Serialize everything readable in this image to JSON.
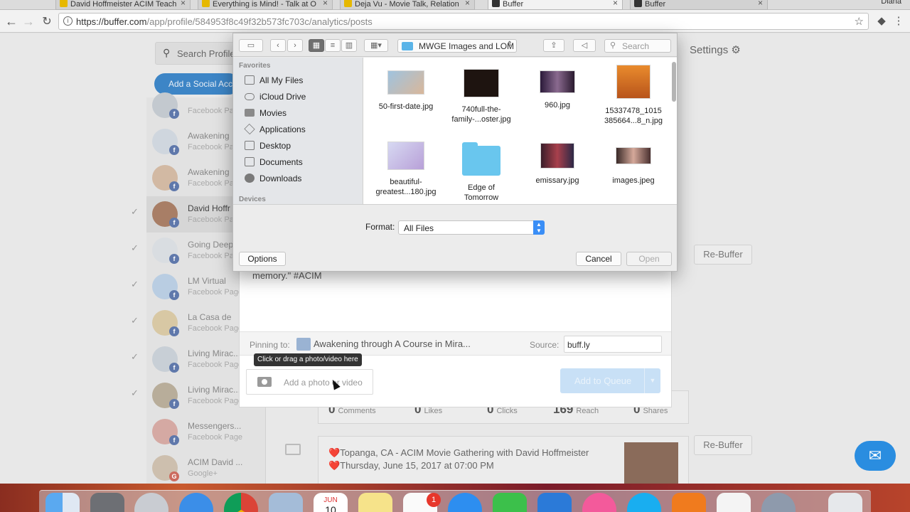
{
  "browser": {
    "tabs": [
      {
        "title": "David Hoffmeister ACIM Teach"
      },
      {
        "title": "Everything is Mind! - Talk at O"
      },
      {
        "title": "Deja Vu - Movie Talk, Relation"
      },
      {
        "title": "Buffer"
      },
      {
        "title": "Buffer"
      }
    ],
    "profile_name": "Diana",
    "url_host": "https://buffer.com",
    "url_path": "/app/profile/584953f8c49f32b573fc703c/analytics/posts"
  },
  "app": {
    "search_placeholder": "Search Profile",
    "add_social_label": "Add a Social Account",
    "settings_label": "Settings",
    "profiles": [
      {
        "name": "",
        "type": "Facebook Page",
        "net": "f"
      },
      {
        "name": "Awakening",
        "type": "Facebook Page",
        "net": "f"
      },
      {
        "name": "Awakening",
        "type": "Facebook Page",
        "net": "f"
      },
      {
        "name": "David Hoffr",
        "type": "Facebook Page",
        "net": "f"
      },
      {
        "name": "Going Deep",
        "type": "Facebook Page",
        "net": "f"
      },
      {
        "name": "LM Virtual",
        "type": "Facebook Page",
        "net": "f"
      },
      {
        "name": "La Casa de",
        "type": "Facebook Page",
        "net": "f"
      },
      {
        "name": "Living Mirac...",
        "type": "Facebook Page",
        "net": "f"
      },
      {
        "name": "Living Mirac...",
        "type": "Facebook Page",
        "net": "f"
      },
      {
        "name": "Messengers...",
        "type": "Facebook Page",
        "net": "f"
      },
      {
        "name": "ACIM David ...",
        "type": "Google+",
        "net": "g"
      }
    ],
    "rebuffer_label": "Re-Buffer",
    "stats": [
      {
        "value": "0",
        "label": "Comments"
      },
      {
        "value": "0",
        "label": "Likes"
      },
      {
        "value": "0",
        "label": "Clicks"
      },
      {
        "value": "169",
        "label": "Reach"
      },
      {
        "value": "0",
        "label": "Shares"
      }
    ],
    "post2_text": "❤️Topanga, CA - ACIM Movie Gathering with David Hoffmeister ❤️Thursday, June 15, 2017 at 07:00 PM"
  },
  "composer": {
    "text_fragment": "memory.\"  #ACIM",
    "pinning_label": "Pinning to:",
    "board_name": "Awakening through A Course in Mira...",
    "source_label": "Source:",
    "source_value": "buff.ly",
    "tooltip": "Click or drag a photo/video here",
    "add_photo_label": "Add a photo or video",
    "queue_label": "Add to Queue"
  },
  "dialog": {
    "current_folder": "MWGE Images and LOM",
    "search_placeholder": "Search",
    "favorites_header": "Favorites",
    "favorites": [
      {
        "label": "All My Files",
        "icon": "all-files-icon"
      },
      {
        "label": "iCloud Drive",
        "icon": "cloud-icon"
      },
      {
        "label": "Movies",
        "icon": "folder-icon"
      },
      {
        "label": "Applications",
        "icon": "applications-icon"
      },
      {
        "label": "Desktop",
        "icon": "desktop-icon"
      },
      {
        "label": "Documents",
        "icon": "documents-icon"
      },
      {
        "label": "Downloads",
        "icon": "downloads-icon"
      }
    ],
    "devices_header": "Devices",
    "files": [
      {
        "line1": "50-first-date.jpg",
        "line2": ""
      },
      {
        "line1": "740full-the-",
        "line2": "family-...oster.jpg"
      },
      {
        "line1": "960.jpg",
        "line2": ""
      },
      {
        "line1": "15337478_1015",
        "line2": "385664...8_n.jpg"
      },
      {
        "line1": "beautiful-",
        "line2": "greatest...180.jpg"
      },
      {
        "line1": "Edge of",
        "line2": "Tomorrow"
      },
      {
        "line1": "emissary.jpg",
        "line2": ""
      },
      {
        "line1": "images.jpeg",
        "line2": ""
      }
    ],
    "format_label": "Format:",
    "format_value": "All Files",
    "options_label": "Options",
    "cancel_label": "Cancel",
    "open_label": "Open"
  },
  "colors": {
    "buffer_blue": "#2a8de0",
    "mac_accent": "#3a8ef6",
    "badge_red": "#e7362b"
  },
  "dock": {
    "calendar_month": "JUN",
    "calendar_day": "10",
    "notification_badge": "1"
  }
}
